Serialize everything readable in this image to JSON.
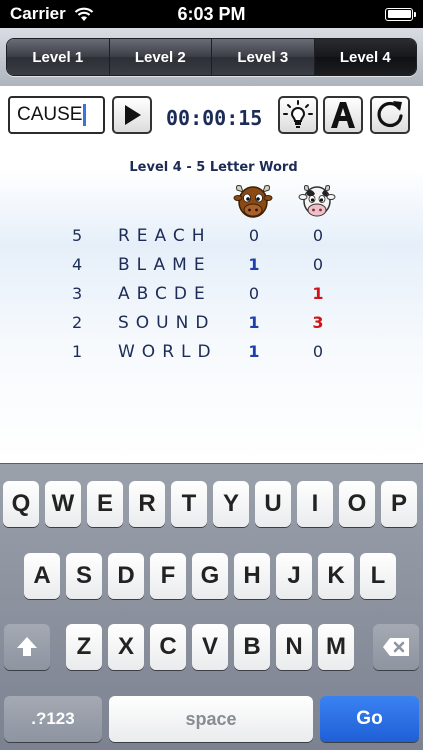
{
  "status_bar": {
    "carrier": "Carrier",
    "time": "6:03 PM",
    "battery_level": 1.0
  },
  "levels": {
    "items": [
      "Level 1",
      "Level 2",
      "Level 3",
      "Level 4"
    ],
    "active_index": 3
  },
  "game": {
    "input_value": "CAUSE",
    "timer": "00:00:15",
    "title": "Level 4 - 5 Letter Word",
    "guesses": [
      {
        "num": "5",
        "word": "REACH",
        "bulls": "0",
        "cows": "0",
        "bulls_color": "default",
        "cows_color": "default"
      },
      {
        "num": "4",
        "word": "BLAME",
        "bulls": "1",
        "cows": "0",
        "bulls_color": "blue",
        "cows_color": "default"
      },
      {
        "num": "3",
        "word": "ABCDE",
        "bulls": "0",
        "cows": "1",
        "bulls_color": "default",
        "cows_color": "red"
      },
      {
        "num": "2",
        "word": "SOUND",
        "bulls": "1",
        "cows": "3",
        "bulls_color": "blue",
        "cows_color": "red"
      },
      {
        "num": "1",
        "word": "WORLD",
        "bulls": "1",
        "cows": "0",
        "bulls_color": "blue",
        "cows_color": "default"
      }
    ],
    "icons": {
      "play": "play-icon",
      "hint": "lightbulb-icon",
      "letters": "letter-a-icon",
      "restart": "restart-icon",
      "bull": "bull-icon",
      "cow": "cow-icon"
    }
  },
  "keyboard": {
    "row1": [
      "Q",
      "W",
      "E",
      "R",
      "T",
      "Y",
      "U",
      "I",
      "O",
      "P"
    ],
    "row2": [
      "A",
      "S",
      "D",
      "F",
      "G",
      "H",
      "J",
      "K",
      "L"
    ],
    "row3": [
      "Z",
      "X",
      "C",
      "V",
      "B",
      "N",
      "M"
    ],
    "numbers_label": ".?123",
    "space_label": "space",
    "go_label": "Go",
    "shift_icon": "shift-icon",
    "delete_icon": "delete-icon"
  },
  "colors": {
    "text_navy": "#1d2c57",
    "bull_blue": "#1d3fb0",
    "cow_red": "#d0131a",
    "go_blue": "#1f5fd6"
  }
}
